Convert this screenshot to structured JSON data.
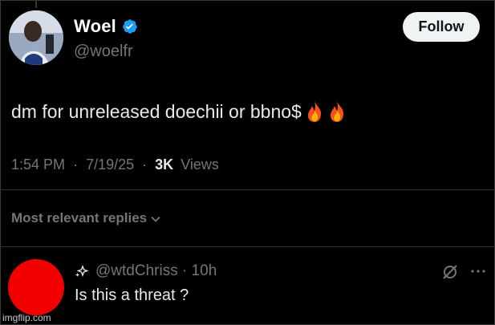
{
  "tweet": {
    "author_name": "Woel",
    "handle": "@woelfr",
    "follow_label": "Follow",
    "text": "dm for unreleased doechii or bbno$",
    "emojis": [
      "fire-icon",
      "fire-icon"
    ],
    "time": "1:54 PM",
    "date": "7/19/25",
    "separator": "·",
    "views_count": "3K",
    "views_label": "Views"
  },
  "replies": {
    "sort_label": "Most relevant replies",
    "items": [
      {
        "handle": "@wtdChriss",
        "time_ago": "10h",
        "text": "Is this a threat ?",
        "avatar_color": "#f20000"
      }
    ]
  },
  "watermark": "imgflip.com",
  "colors": {
    "background": "#000000",
    "primary_text": "#e7e9ea",
    "secondary_text": "#71767b",
    "verified_blue": "#1d9bf0",
    "follow_button_bg": "#eff3f4"
  }
}
